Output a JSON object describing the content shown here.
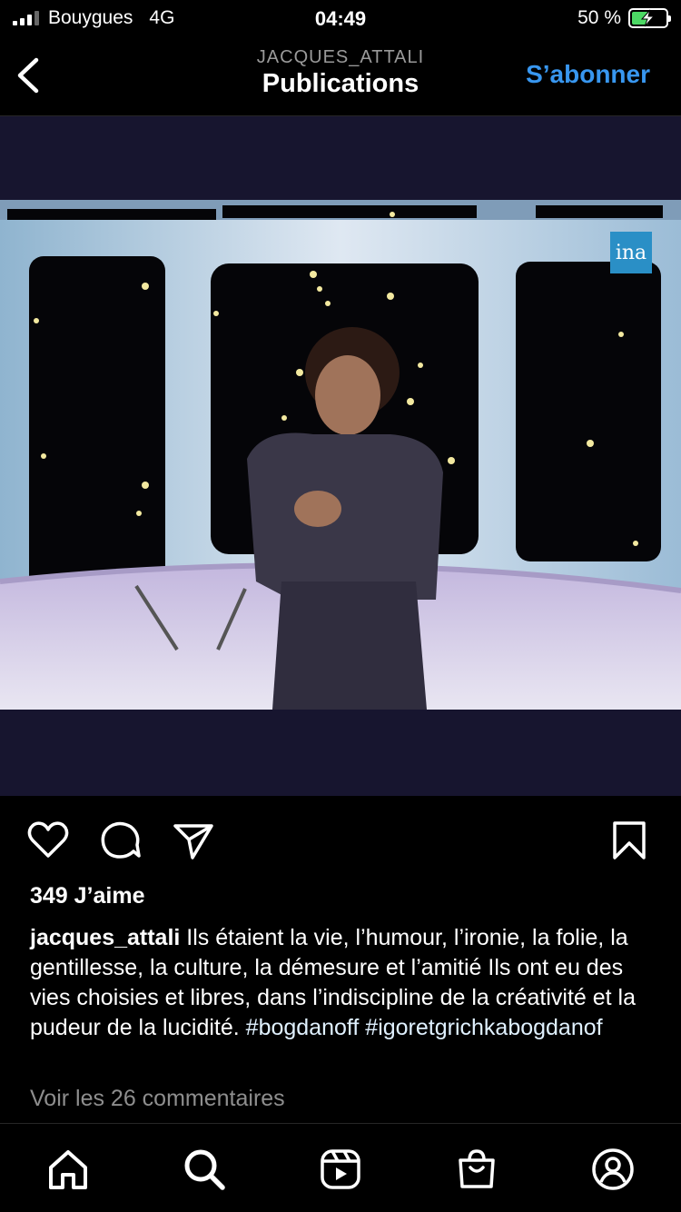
{
  "status_bar": {
    "carrier": "Bouygues",
    "network": "4G",
    "time": "04:49",
    "battery_percent": "50 %",
    "battery_level": 0.5
  },
  "header": {
    "account": "JACQUES_ATTALI",
    "title": "Publications",
    "subscribe_label": "S’abonner"
  },
  "media": {
    "watermark": "ina"
  },
  "post": {
    "likes": "349 J’aime",
    "username": "jacques_attali",
    "caption": " Ils étaient la vie, l’humour, l’ironie, la folie, la gentillesse, la culture, la démesure et l’amitié Ils ont eu des vies choisies et libres, dans l’indiscipline de la créativité et la pudeur de la lucidité. ",
    "hashtags": "#bogdanoff #igoretgrichkabogdanof",
    "comments_link": "Voir les 26 commentaires"
  },
  "colors": {
    "accent": "#3897f0",
    "background": "#000000",
    "media_bg": "#17152f"
  }
}
